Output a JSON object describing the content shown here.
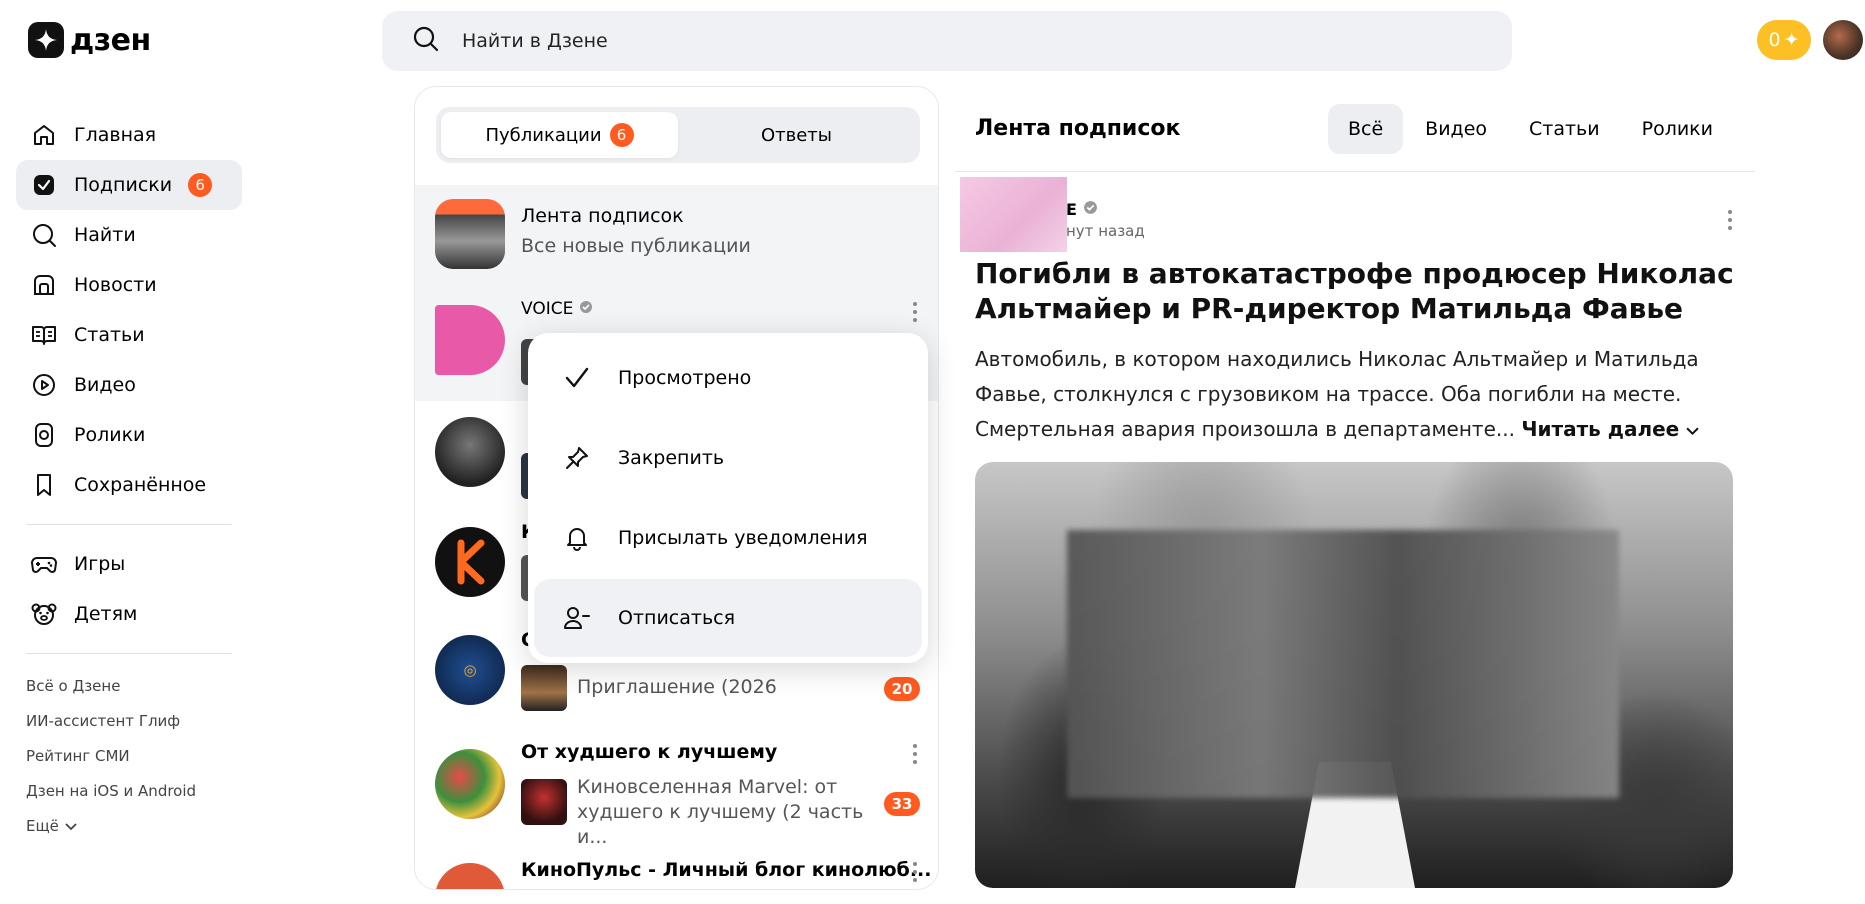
{
  "app": {
    "logo_text": "дзен"
  },
  "search": {
    "placeholder": "Найти в Дзене"
  },
  "header": {
    "coin_value": "0"
  },
  "sidebar": {
    "items": [
      {
        "label": "Главная",
        "icon": "home-icon"
      },
      {
        "label": "Подписки",
        "icon": "subscriptions-icon",
        "badge": "6",
        "active": true
      },
      {
        "label": "Найти",
        "icon": "search-icon"
      },
      {
        "label": "Новости",
        "icon": "news-icon"
      },
      {
        "label": "Статьи",
        "icon": "articles-icon"
      },
      {
        "label": "Видео",
        "icon": "video-icon"
      },
      {
        "label": "Ролики",
        "icon": "shorts-icon"
      },
      {
        "label": "Сохранённое",
        "icon": "bookmark-icon"
      }
    ],
    "secondary": [
      {
        "label": "Игры",
        "icon": "gamepad-icon"
      },
      {
        "label": "Детям",
        "icon": "bear-icon"
      }
    ],
    "footer_links": [
      "Всё о Дзене",
      "ИИ-ассистент Глиф",
      "Рейтинг СМИ",
      "Дзен на iOS и Android",
      "Ещё"
    ]
  },
  "subscriptions": {
    "tabs": [
      {
        "label": "Публикации",
        "badge": "6",
        "active": true
      },
      {
        "label": "Ответы"
      }
    ],
    "feed_row": {
      "title": "Лента подписок",
      "subtitle": "Все новые публикации"
    },
    "rows": [
      {
        "title": "VOICE",
        "count": ""
      },
      {
        "title": "",
        "count": ""
      },
      {
        "title": "К",
        "count": ""
      },
      {
        "title": "С",
        "preview": "Приглашение (2026",
        "count": "20"
      },
      {
        "title": "От худшего к лучшему",
        "preview": "Киновселенная Marvel: от худшего к лучшему (2 часть и...",
        "count": "33"
      },
      {
        "title": "КиноПульс - Личный блог кинолюб..."
      }
    ]
  },
  "context_menu": {
    "items": [
      {
        "label": "Просмотрено",
        "icon": "check-icon"
      },
      {
        "label": "Закрепить",
        "icon": "pin-icon"
      },
      {
        "label": "Присылать уведомления",
        "icon": "bell-icon"
      },
      {
        "label": "Отписаться",
        "icon": "unsubscribe-icon"
      }
    ]
  },
  "feed": {
    "title": "Лента подписок",
    "tabs": [
      "Всё",
      "Видео",
      "Статьи",
      "Ролики"
    ],
    "post": {
      "author": "E",
      "time": "нут назад",
      "title": "Погибли в автокатастрофе продюсер Николас Альтмайер и PR-директор Матильда Фавье",
      "text": "Автомобиль, в котором находились Николас Альтмайер и Матильда Фавье, столкнулся с грузовиком на трассе. Оба погибли на месте. Смертельная авария произошла в департаменте...",
      "read_more": "Читать далее"
    }
  }
}
